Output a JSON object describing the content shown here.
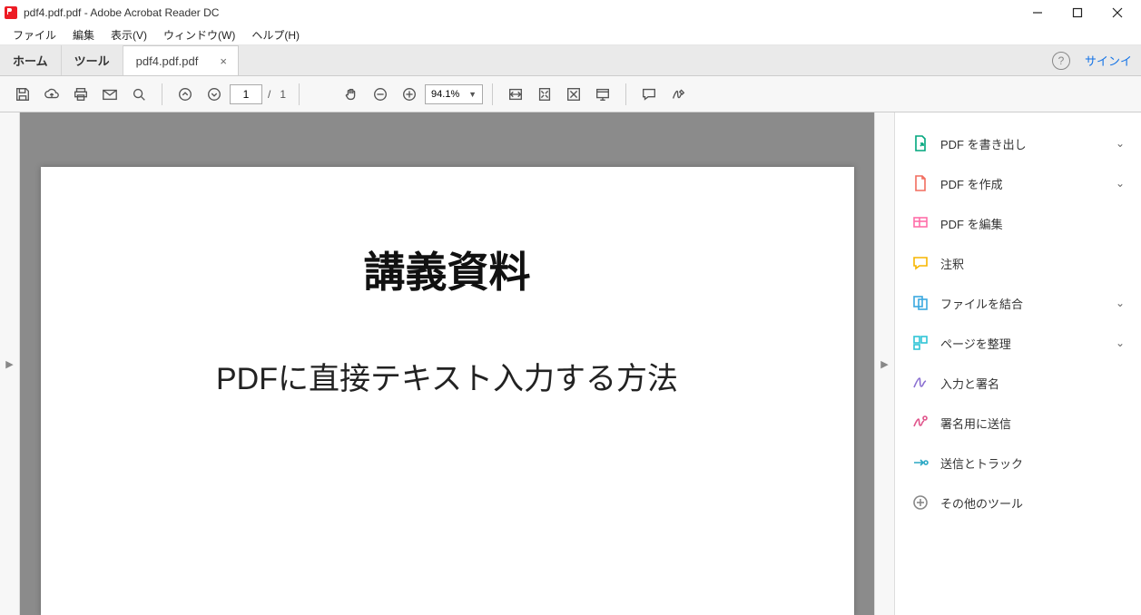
{
  "title": "pdf4.pdf.pdf - Adobe Acrobat Reader DC",
  "menu": {
    "file": "ファイル",
    "edit": "編集",
    "view": "表示(V)",
    "window": "ウィンドウ(W)",
    "help": "ヘルプ(H)"
  },
  "tabs": {
    "home": "ホーム",
    "tools": "ツール",
    "doc": "pdf4.pdf.pdf"
  },
  "signin": "サインイ",
  "page": {
    "current": "1",
    "sep": "/",
    "total": "1"
  },
  "zoom": "94.1%",
  "pdf": {
    "title": "講義資料",
    "subtitle": "PDFに直接テキスト入力する方法"
  },
  "tools_panel": {
    "export": "PDF を書き出し",
    "create": "PDF を作成",
    "edit": "PDF を編集",
    "comment": "注釈",
    "combine": "ファイルを結合",
    "organize": "ページを整理",
    "fill": "入力と署名",
    "send_sign": "署名用に送信",
    "send_track": "送信とトラック",
    "more": "その他のツール"
  }
}
